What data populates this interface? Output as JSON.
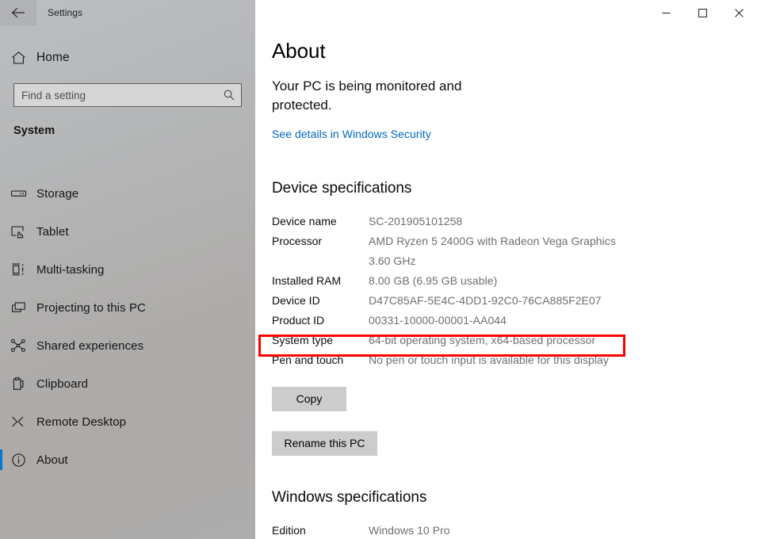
{
  "window": {
    "app_title": "Settings",
    "back_icon": "back-arrow-icon",
    "controls": {
      "minimize": "minimize-icon",
      "maximize": "maximize-icon",
      "close": "close-icon"
    }
  },
  "sidebar": {
    "home": {
      "label": "Home",
      "icon": "home-icon"
    },
    "search": {
      "placeholder": "Find a setting",
      "value": "",
      "icon": "search-icon"
    },
    "group_header": "System",
    "items": [
      {
        "label": "Storage",
        "icon": "storage-drive-icon",
        "selected": false
      },
      {
        "label": "Tablet",
        "icon": "tablet-touch-icon",
        "selected": false
      },
      {
        "label": "Multi-tasking",
        "icon": "multitasking-icon",
        "selected": false
      },
      {
        "label": "Projecting to this PC",
        "icon": "projecting-icon",
        "selected": false
      },
      {
        "label": "Shared experiences",
        "icon": "shared-experiences-icon",
        "selected": false
      },
      {
        "label": "Clipboard",
        "icon": "clipboard-icon",
        "selected": false
      },
      {
        "label": "Remote Desktop",
        "icon": "remote-desktop-icon",
        "selected": false
      },
      {
        "label": "About",
        "icon": "info-circle-icon",
        "selected": true
      }
    ]
  },
  "main": {
    "page_title": "About",
    "status_text": "Your PC is being monitored and protected.",
    "security_link": "See details in Windows Security",
    "device_specifications": {
      "title": "Device specifications",
      "rows": [
        {
          "label": "Device name",
          "value": "SC-201905101258"
        },
        {
          "label": "Processor",
          "value": "AMD Ryzen 5 2400G with Radeon Vega Graphics",
          "value_line2": "3.60 GHz"
        },
        {
          "label": "Installed RAM",
          "value": "8.00 GB (6.95 GB usable)"
        },
        {
          "label": "Device ID",
          "value": "D47C85AF-5E4C-4DD1-92C0-76CA885F2E07"
        },
        {
          "label": "Product ID",
          "value": "00331-10000-00001-AA044"
        },
        {
          "label": "System type",
          "value": "64-bit operating system, x64-based processor",
          "highlighted": true
        },
        {
          "label": "Pen and touch",
          "value": "No pen or touch input is available for this display"
        }
      ],
      "copy_button": "Copy",
      "rename_button": "Rename this PC"
    },
    "windows_specifications": {
      "title": "Windows specifications",
      "rows": [
        {
          "label": "Edition",
          "value": "Windows 10 Pro"
        }
      ]
    }
  },
  "colors": {
    "accent": "#0078d7",
    "link": "#0067c0",
    "highlight_box": "#ff0000",
    "sidebar_top": "#bcbfc2",
    "sidebar_bottom": "#adadad",
    "button_face": "#cccccc",
    "value_text": "#6f6f6f"
  }
}
